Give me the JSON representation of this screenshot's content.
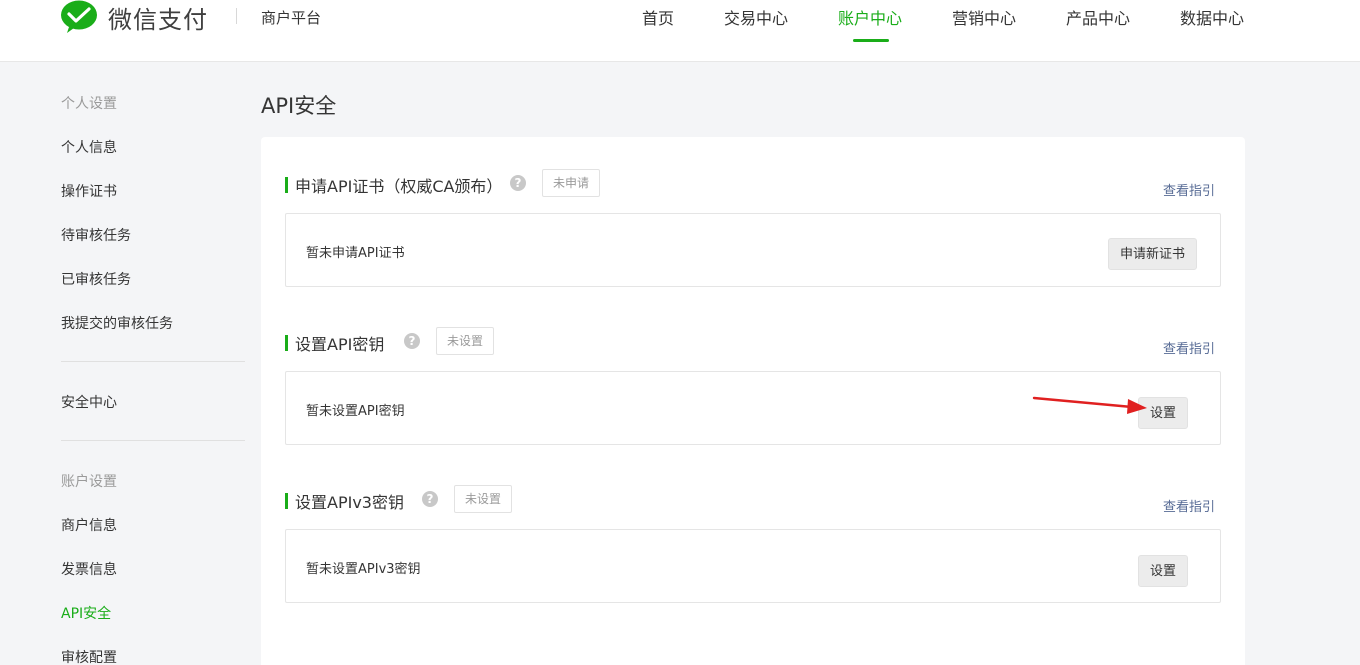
{
  "header": {
    "brand": "微信支付",
    "sub_brand": "商户平台",
    "nav": [
      "首页",
      "交易中心",
      "账户中心",
      "营销中心",
      "产品中心",
      "数据中心"
    ],
    "active_nav": "账户中心"
  },
  "sidebar": {
    "group_personal": "个人设置",
    "personal_items": [
      "个人信息",
      "操作证书",
      "待审核任务",
      "已审核任务",
      "我提交的审核任务"
    ],
    "security": "安全中心",
    "group_account": "账户设置",
    "account_items": [
      "商户信息",
      "发票信息",
      "API安全",
      "审核配置"
    ],
    "active_item": "API安全"
  },
  "main": {
    "title": "API安全",
    "sections": [
      {
        "title": "申请API证书（权威CA颁布）",
        "help": "?",
        "status": "未申请",
        "guide": "查看指引",
        "message": "暂未申请API证书",
        "button": "申请新证书"
      },
      {
        "title": "设置API密钥",
        "help": "?",
        "status": "未设置",
        "guide": "查看指引",
        "message": "暂未设置API密钥",
        "button": "设置"
      },
      {
        "title": "设置APIv3密钥",
        "help": "?",
        "status": "未设置",
        "guide": "查看指引",
        "message": "暂未设置APIv3密钥",
        "button": "设置"
      }
    ]
  },
  "colors": {
    "accent": "#1aad19",
    "link": "#576b95",
    "annotation_arrow": "#e02020"
  },
  "icons": {
    "logo": "wechat-pay-logo-icon",
    "help": "question-circle-icon",
    "annotation": "red-arrow-icon"
  }
}
